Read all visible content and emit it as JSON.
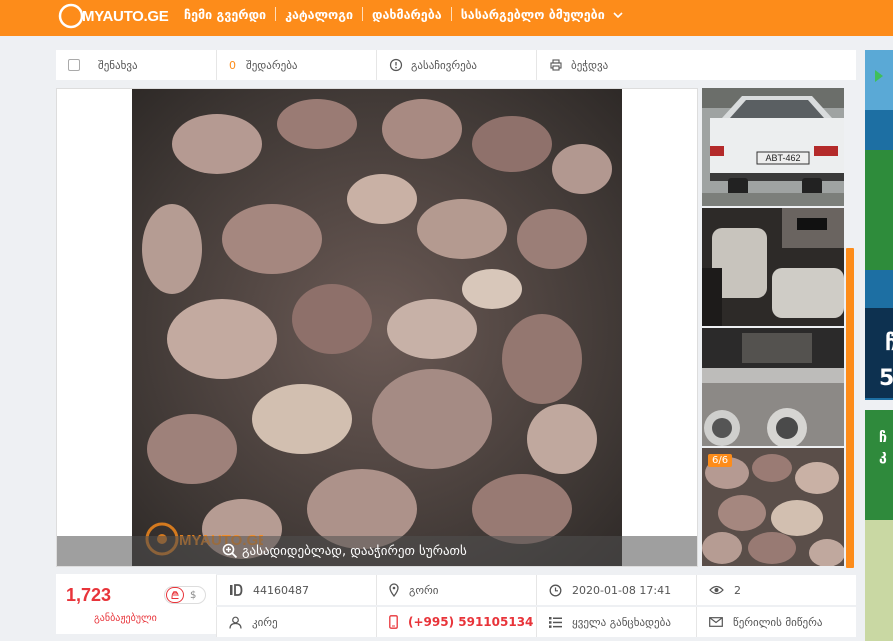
{
  "header": {
    "logo_text": "MYAUTO.GE",
    "nav": [
      "ჩემი გვერდი",
      "კატალოგი",
      "დახმარება",
      "სასარგებლო ბმულები"
    ]
  },
  "actions": {
    "save": "შენახვა",
    "compare_count": "0",
    "compare": "შედარება",
    "report": "გასაჩივრება",
    "print": "ბეჭდვა"
  },
  "gallery": {
    "zoom_hint": "გასადიდებლად, დააჭირეთ სურათს",
    "watermark": "MYAUTO.GE",
    "counter": "6/6",
    "thumb_plate": "ABT-462"
  },
  "listing": {
    "price": "1,723",
    "currency_alt": "$",
    "price_note": "განბაჟებული",
    "id": "44160487",
    "location": "გორი",
    "date": "2020-01-08 17:41",
    "views": "2",
    "seller": "კირე",
    "phone": "(+995) 591105134",
    "all_ads": "ყველა განცხადება",
    "message": "წერილის მიწერა"
  },
  "colors": {
    "brand": "#fd8c1a",
    "price": "#e8343a"
  }
}
